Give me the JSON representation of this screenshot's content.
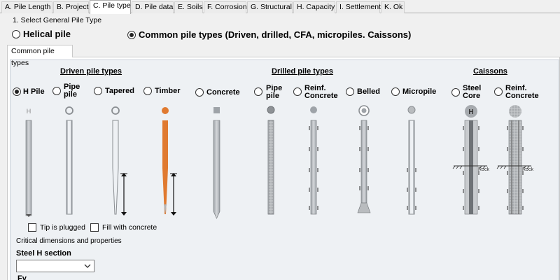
{
  "tabs": [
    {
      "label": "A. Pile Length",
      "active": false
    },
    {
      "label": "B. Project",
      "active": false
    },
    {
      "label": "C. Pile type",
      "active": true
    },
    {
      "label": "D. Pile data",
      "active": false
    },
    {
      "label": "E. Soils",
      "active": false
    },
    {
      "label": "F. Corrosion",
      "active": false
    },
    {
      "label": "G. Structural",
      "active": false
    },
    {
      "label": "H. Capacity",
      "active": false
    },
    {
      "label": "I. Settlement",
      "active": false
    },
    {
      "label": "K. Ok",
      "active": false
    }
  ],
  "section_title": "1. Select General Pile Type",
  "general_type": {
    "helical_label": "Helical pile",
    "common_label": "Common pile types (Driven, drilled, CFA, micropiles. Caissons)",
    "selected": "common"
  },
  "inner_tab_label": "Common pile types",
  "groups": {
    "driven": "Driven pile types",
    "drilled": "Drilled pile types",
    "caissons": "Caissons"
  },
  "pile_options": [
    {
      "id": "h-pile",
      "label": "H Pile",
      "selected": true
    },
    {
      "id": "pipe-pile-driven",
      "label": "Pipe\npile",
      "selected": false
    },
    {
      "id": "tapered",
      "label": "Tapered",
      "selected": false
    },
    {
      "id": "timber",
      "label": "Timber",
      "selected": false
    },
    {
      "id": "concrete",
      "label": "Concrete",
      "selected": false
    },
    {
      "id": "pipe-pile-drilled",
      "label": "Pipe\npile",
      "selected": false
    },
    {
      "id": "reinf-concrete",
      "label": "Reinf.\nConcrete",
      "selected": false
    },
    {
      "id": "belled",
      "label": "Belled",
      "selected": false
    },
    {
      "id": "micropile",
      "label": "Micropile",
      "selected": false
    },
    {
      "id": "steel-core",
      "label": "Steel\nCore",
      "selected": false
    },
    {
      "id": "reinf-concrete-caisson",
      "label": "Reinf.\nConcrete",
      "selected": false
    }
  ],
  "diagram_labels": {
    "h_glyph": "H",
    "rock_1": "Rock",
    "rock_2": "Rock"
  },
  "checkboxes": [
    {
      "id": "tip-plugged",
      "label": "Tip is plugged",
      "checked": false
    },
    {
      "id": "fill-concrete",
      "label": "Fill with concrete",
      "checked": false
    }
  ],
  "critical_dims_title": "Critical dimensions and properties",
  "steel_h_section_label": "Steel H section",
  "steel_h_section_value": "",
  "fy_label": "Fy",
  "colors": {
    "timber": "#e07a30",
    "pile_gray": "#b4b8bc",
    "pile_outline": "#6e7276"
  }
}
